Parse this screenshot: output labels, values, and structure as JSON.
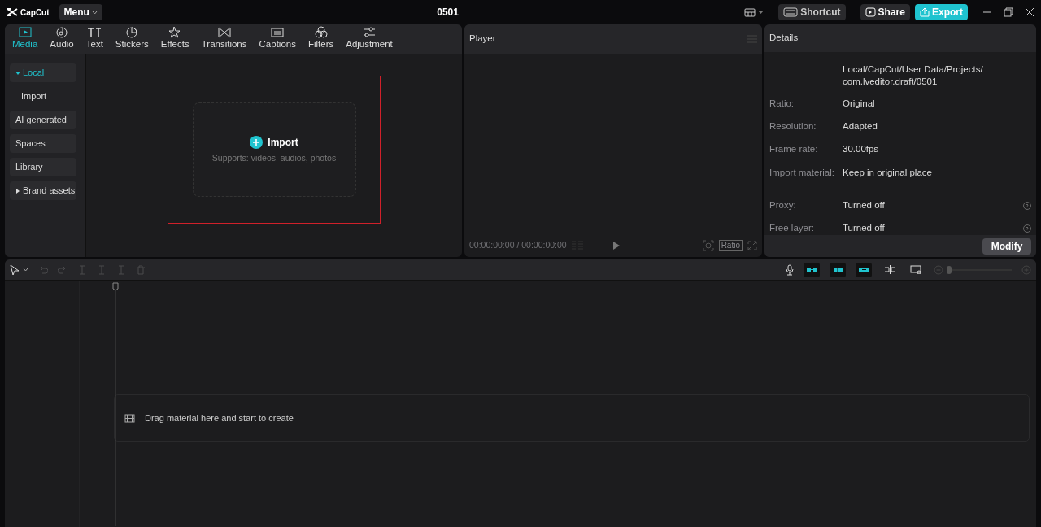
{
  "titlebar": {
    "app": "CapCut",
    "menu": "Menu",
    "project": "0501",
    "shortcut": "Shortcut",
    "share": "Share",
    "export": "Export"
  },
  "tabs": [
    {
      "label": "Media",
      "selected": true
    },
    {
      "label": "Audio",
      "selected": false
    },
    {
      "label": "Text",
      "selected": false
    },
    {
      "label": "Stickers",
      "selected": false
    },
    {
      "label": "Effects",
      "selected": false
    },
    {
      "label": "Transitions",
      "selected": false
    },
    {
      "label": "Captions",
      "selected": false
    },
    {
      "label": "Filters",
      "selected": false
    },
    {
      "label": "Adjustment",
      "selected": false
    }
  ],
  "sidebar": {
    "items": [
      {
        "label": "Local",
        "kind": "folder",
        "expanded": true,
        "selected": true,
        "children": [
          {
            "label": "Import",
            "selected": false
          }
        ]
      },
      {
        "label": "AI generated",
        "kind": "link",
        "selected": false
      },
      {
        "label": "Spaces",
        "kind": "link",
        "selected": false
      },
      {
        "label": "Library",
        "kind": "link",
        "selected": false
      },
      {
        "label": "Brand assets",
        "kind": "folder",
        "expanded": false,
        "selected": false
      }
    ]
  },
  "import": {
    "label": "Import",
    "hint": "Supports: videos, audios, photos"
  },
  "player": {
    "title": "Player",
    "timecode": "00:00:00:00 / 00:00:00:00",
    "ratio": "Ratio"
  },
  "details": {
    "title": "Details",
    "path": "Local/CapCut/User Data/Projects/ com.lveditor.draft/0501",
    "rows": [
      {
        "label": "Ratio:",
        "value": "Original"
      },
      {
        "label": "Resolution:",
        "value": "Adapted"
      },
      {
        "label": "Frame rate:",
        "value": "30.00fps"
      },
      {
        "label": "Import material:",
        "value": "Keep in original place"
      }
    ],
    "settings": [
      {
        "label": "Proxy:",
        "value": "Turned off"
      },
      {
        "label": "Free layer:",
        "value": "Turned off"
      }
    ],
    "modify": "Modify"
  },
  "timeline": {
    "toggles": [
      {
        "on": true
      },
      {
        "on": true
      },
      {
        "on": true
      },
      {
        "on": false
      },
      {
        "on": false
      }
    ],
    "zoom": {
      "level": 0.0
    },
    "hint": "Drag material here and start to create"
  }
}
